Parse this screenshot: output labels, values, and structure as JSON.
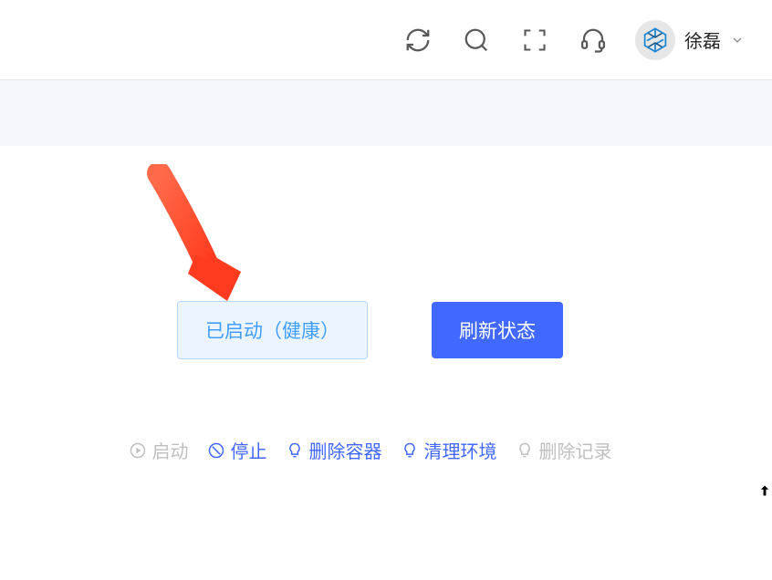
{
  "header": {
    "username": "徐磊"
  },
  "status": {
    "label": "已启动（健康）",
    "refresh": "刷新状态"
  },
  "actions": {
    "start": "启动",
    "stop": "停止",
    "deleteContainer": "删除容器",
    "cleanEnv": "清理环境",
    "deleteRecord": "删除记录"
  }
}
